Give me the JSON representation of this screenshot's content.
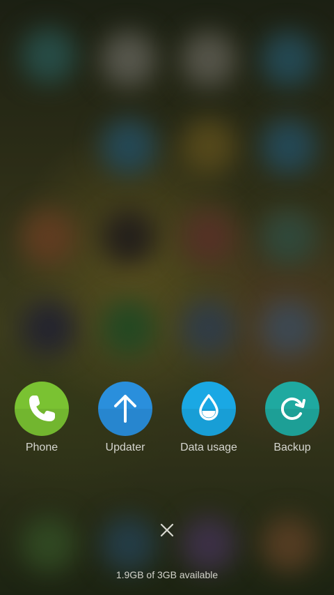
{
  "shortcuts": [
    {
      "label": "Phone",
      "icon": "phone-icon",
      "color": "#7ac232"
    },
    {
      "label": "Updater",
      "icon": "arrow-up-icon",
      "color": "#2a8fdc"
    },
    {
      "label": "Data usage",
      "icon": "water-drop-icon",
      "color": "#1aa8e4"
    },
    {
      "label": "Backup",
      "icon": "refresh-icon",
      "color": "#1fa9a0"
    }
  ],
  "close": {
    "icon": "close-icon"
  },
  "memory": {
    "text": "1.9GB of 3GB available"
  }
}
